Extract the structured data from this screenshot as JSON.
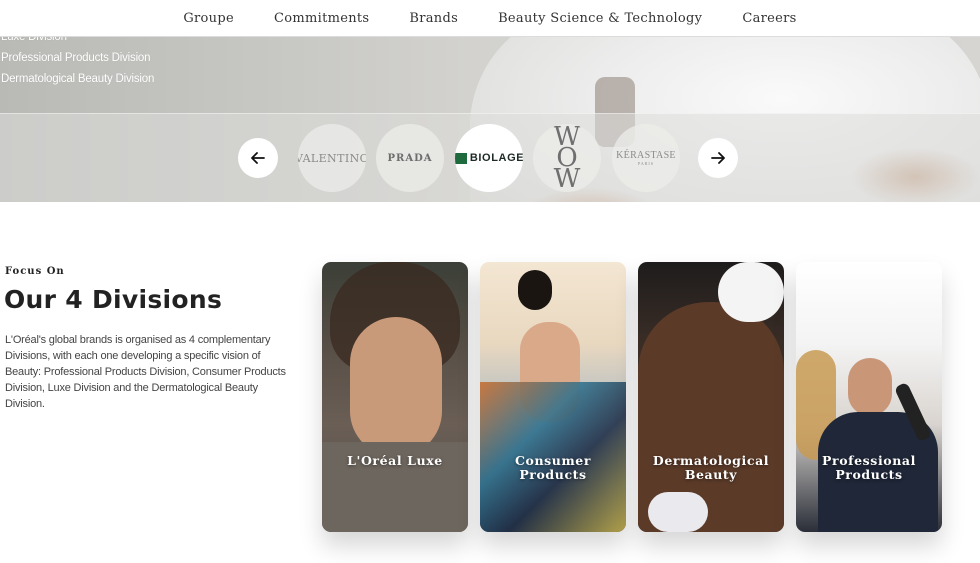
{
  "nav": {
    "items": [
      "Groupe",
      "Commitments",
      "Brands",
      "Beauty Science & Technology",
      "Careers"
    ]
  },
  "hero": {
    "division_links": [
      "Luxe Division",
      "Professional Products Division",
      "Dermatological Beauty Division"
    ],
    "brands": [
      {
        "name": "VALENTINO"
      },
      {
        "name": "PRADA"
      },
      {
        "name": "BIOLAGE",
        "active": true
      },
      {
        "name": "WOW"
      },
      {
        "name": "KÉRASTASE",
        "sub": "PARIS"
      }
    ],
    "prev_icon": "arrow-left-icon",
    "next_icon": "arrow-right-icon"
  },
  "section": {
    "kicker": "Focus On",
    "title": "Our 4 Divisions",
    "description": "L'Oréal's global brands is organised as 4 complementary Divisions, with each one developing a specific vision of Beauty: Professional Products Division, Consumer Products Division, Luxe Division and the Dermatological Beauty Division."
  },
  "divisions": [
    {
      "line1": "L'Oréal Luxe",
      "line2": ""
    },
    {
      "line1": "Consumer",
      "line2": "Products"
    },
    {
      "line1": "Dermatological",
      "line2": "Beauty"
    },
    {
      "line1": "Professional",
      "line2": "Products"
    }
  ],
  "colors": {
    "biolage_green": "#1f6b3e",
    "nav_text": "#333333",
    "card_label": "#ffffff"
  }
}
